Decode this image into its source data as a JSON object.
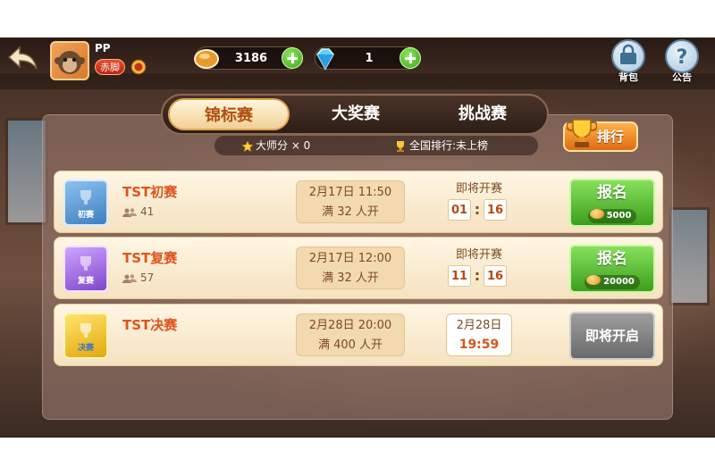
{
  "player": {
    "name": "PP",
    "rank_title": "赤脚"
  },
  "currency": {
    "coins": "3186",
    "gems": "1"
  },
  "top_buttons": {
    "bag_label": "背包",
    "notice_label": "公告"
  },
  "tabs": [
    {
      "label": "锦标赛",
      "active": true
    },
    {
      "label": "大奖赛",
      "active": false
    },
    {
      "label": "挑战赛",
      "active": false
    }
  ],
  "stats": {
    "master_points": "大师分 × 0",
    "national_rank": "全国排行:未上榜"
  },
  "rank_button": {
    "label": "排行"
  },
  "matches": [
    {
      "ticket_label": "初赛",
      "ticket_color": "#5b9bd8",
      "name": "TST初赛",
      "players": "41",
      "time_line1": "2月17日 11:50",
      "time_line2": "满 32 人开",
      "countdown_title": "即将开赛",
      "countdown_h": "01",
      "countdown_m": "16",
      "action_label": "报名",
      "fee": "5000"
    },
    {
      "ticket_label": "复赛",
      "ticket_color": "#a56ae0",
      "name": "TST复赛",
      "players": "57",
      "time_line1": "2月17日 12:00",
      "time_line2": "满 32 人开",
      "countdown_title": "即将开赛",
      "countdown_h": "11",
      "countdown_m": "16",
      "action_label": "报名",
      "fee": "20000"
    },
    {
      "ticket_label": "决赛",
      "ticket_color": "#f1c02a",
      "name": "TST决赛",
      "time_line1": "2月28日 20:00",
      "time_line2": "满 400 人开",
      "date_line1": "2月28日",
      "date_line2": "19:59",
      "action_label": "即将开启"
    }
  ],
  "colors": {
    "accent": "#e0531c",
    "signup_green": "#3f9e1e",
    "panel_row": "#fff6e4"
  }
}
